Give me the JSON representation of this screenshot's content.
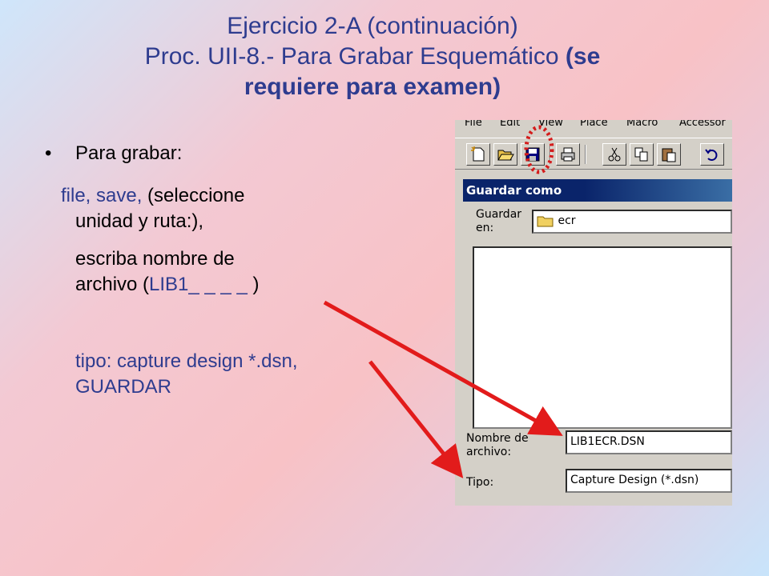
{
  "title": {
    "line1": "Ejercicio 2-A (continuación)",
    "line2_plain": "Proc. UII-8.- Para Grabar Esquemático",
    "line2_bold": "(se",
    "line3_bold": "requiere para examen)"
  },
  "bullets": {
    "marker": "•",
    "head": "Para grabar:",
    "l1_blue": "file, save,",
    "l1_black": " (seleccione",
    "l2": "unidad y ruta:),",
    "l3": "escriba nombre de",
    "l4_black": "archivo (",
    "l4_blue": "LIB1_ _ _ _ ",
    "l4_end": ")",
    "l5": "tipo: capture design *.dsn,",
    "l6": "GUARDAR"
  },
  "screenshot": {
    "menu": [
      "File",
      "Edit",
      "View",
      "Place",
      "Macro",
      "Accessor"
    ],
    "toolbar_icons": [
      "new-icon",
      "open-icon",
      "save-icon",
      "print-icon",
      "cut-icon",
      "copy-icon",
      "paste-icon",
      "undo-icon"
    ],
    "dialog_title": "Guardar como",
    "guardar_en_label_1": "Guardar",
    "guardar_en_label_2": "en:",
    "folder_value": "ecr",
    "nombre_label_1": "Nombre de",
    "nombre_label_2": "archivo:",
    "nombre_value": "LIB1ECR.DSN",
    "tipo_label": "Tipo:",
    "tipo_value": "Capture Design (*.dsn)"
  },
  "colors": {
    "title_blue": "#2e3c8f",
    "arrow_red": "#e21b1b",
    "dialog_blue": "#0a246a"
  }
}
